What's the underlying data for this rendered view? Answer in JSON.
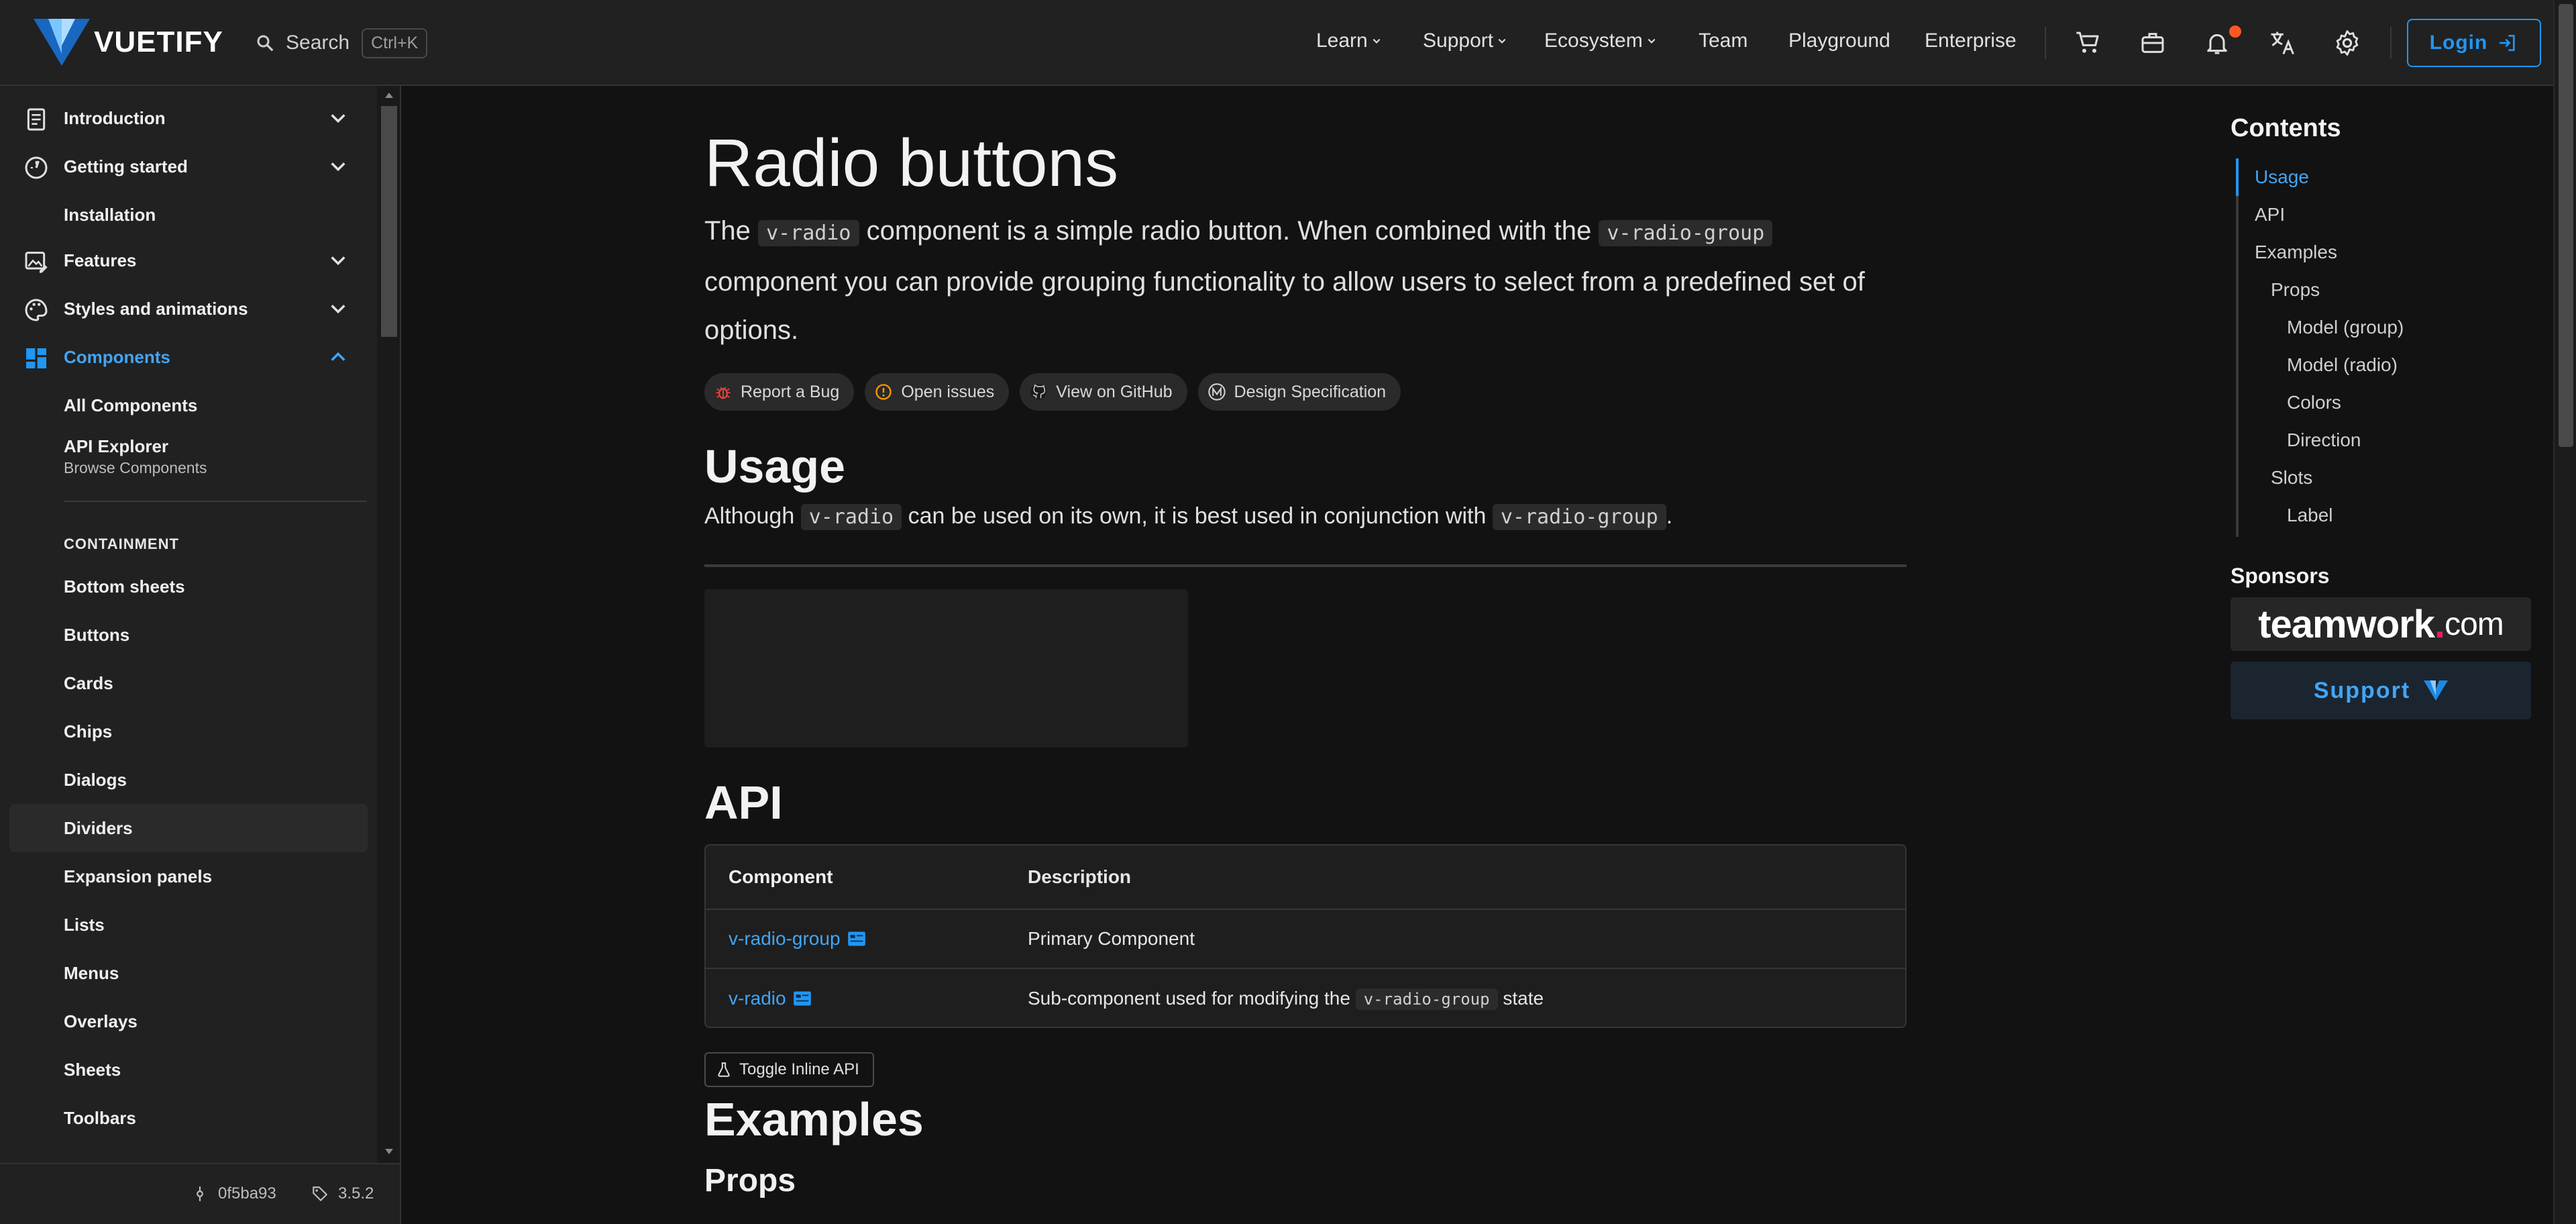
{
  "appbar": {
    "brand": "VUETIFY",
    "search_label": "Search",
    "search_shortcut": "Ctrl+K",
    "nav": [
      {
        "label": "Learn",
        "has_menu": true
      },
      {
        "label": "Support",
        "has_menu": true
      },
      {
        "label": "Ecosystem",
        "has_menu": true
      },
      {
        "label": "Team",
        "has_menu": false
      },
      {
        "label": "Playground",
        "has_menu": false
      },
      {
        "label": "Enterprise",
        "has_menu": false
      }
    ],
    "icons": [
      "cart-icon",
      "briefcase-icon",
      "bell-icon",
      "translate-icon",
      "gear-icon"
    ],
    "login_label": "Login",
    "accent": "#2196f3",
    "notification_color": "#ff5722"
  },
  "sidebar": {
    "groups": [
      {
        "label": "Introduction",
        "icon": "text-box-icon",
        "expanded": false
      },
      {
        "label": "Getting started",
        "icon": "speedometer-icon",
        "expanded": false
      },
      {
        "label": "Features",
        "icon": "image-edit-icon",
        "expanded": false
      },
      {
        "label": "Styles and animations",
        "icon": "palette-icon",
        "expanded": false
      },
      {
        "label": "Components",
        "icon": "view-dashboard-icon",
        "expanded": true
      }
    ],
    "installation": "Installation",
    "all_components": "All Components",
    "api_explorer": "API Explorer",
    "api_explorer_sub": "Browse Components",
    "section_header": "CONTAINMENT",
    "items": [
      "Bottom sheets",
      "Buttons",
      "Cards",
      "Chips",
      "Dialogs",
      "Dividers",
      "Expansion panels",
      "Lists",
      "Menus",
      "Overlays",
      "Sheets",
      "Toolbars"
    ],
    "active_item": "Dividers",
    "footer": {
      "commit": "0f5ba93",
      "version": "3.5.2"
    }
  },
  "main": {
    "title": "Radio buttons",
    "intro": {
      "p1": "The",
      "code1": "v-radio",
      "p2": "component is a simple radio button. When combined with the",
      "code2": "v-radio-group",
      "p3": "component you can provide grouping functionality to allow users to select from a predefined set of options."
    },
    "chips": [
      {
        "label": "Report a Bug",
        "icon": "bug-icon"
      },
      {
        "label": "Open issues",
        "icon": "alert-circle-icon"
      },
      {
        "label": "View on GitHub",
        "icon": "github-icon"
      },
      {
        "label": "Design Specification",
        "icon": "material-design-icon"
      }
    ],
    "usage": {
      "heading": "Usage",
      "t1": "Although",
      "code1": "v-radio",
      "t2": "can be used on its own, it is best used in conjunction with",
      "code2": "v-radio-group",
      "t3": "."
    },
    "api": {
      "heading": "API",
      "headers": [
        "Component",
        "Description"
      ],
      "rows": [
        {
          "component": "v-radio-group",
          "description": "Primary Component"
        },
        {
          "component": "v-radio",
          "description_pre": "Sub-component used for modifying the",
          "description_code": "v-radio-group",
          "description_post": "state"
        }
      ],
      "toggle_label": "Toggle Inline API"
    },
    "examples_heading": "Examples",
    "props_heading": "Props"
  },
  "toc": {
    "title": "Contents",
    "items": [
      {
        "label": "Usage",
        "level": 1,
        "active": true
      },
      {
        "label": "API",
        "level": 1
      },
      {
        "label": "Examples",
        "level": 1
      },
      {
        "label": "Props",
        "level": 2
      },
      {
        "label": "Model (group)",
        "level": 3
      },
      {
        "label": "Model (radio)",
        "level": 3
      },
      {
        "label": "Colors",
        "level": 3
      },
      {
        "label": "Direction",
        "level": 3
      },
      {
        "label": "Slots",
        "level": 2
      },
      {
        "label": "Label",
        "level": 3
      }
    ],
    "sponsors_title": "Sponsors",
    "sponsor_name": "teamwork",
    "sponsor_dot": ".",
    "sponsor_tld": "com",
    "support_label": "Support"
  }
}
